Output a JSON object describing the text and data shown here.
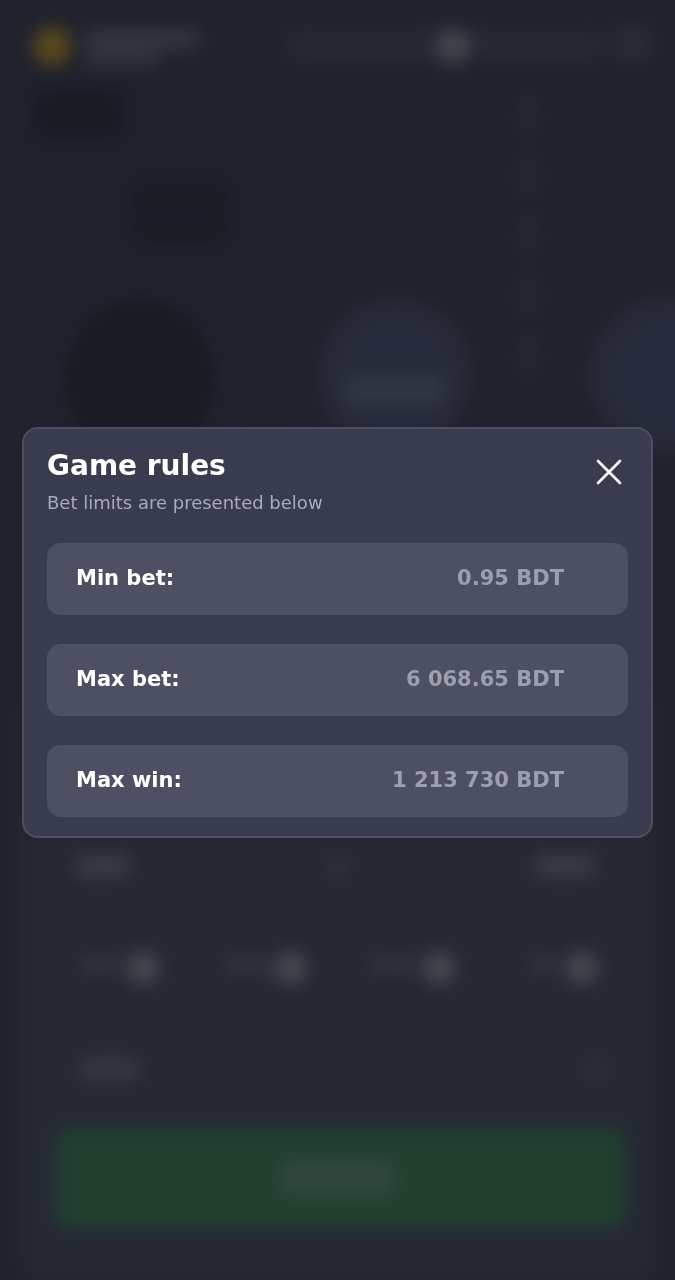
{
  "dialog": {
    "title": "Game rules",
    "subtitle": "Bet limits are presented below",
    "limits": [
      {
        "label": "Min bet:",
        "value": "0.95 BDT"
      },
      {
        "label": "Max bet:",
        "value": "6 068.65 BDT"
      },
      {
        "label": "Max win:",
        "value": "1 213 730 BDT"
      }
    ]
  }
}
